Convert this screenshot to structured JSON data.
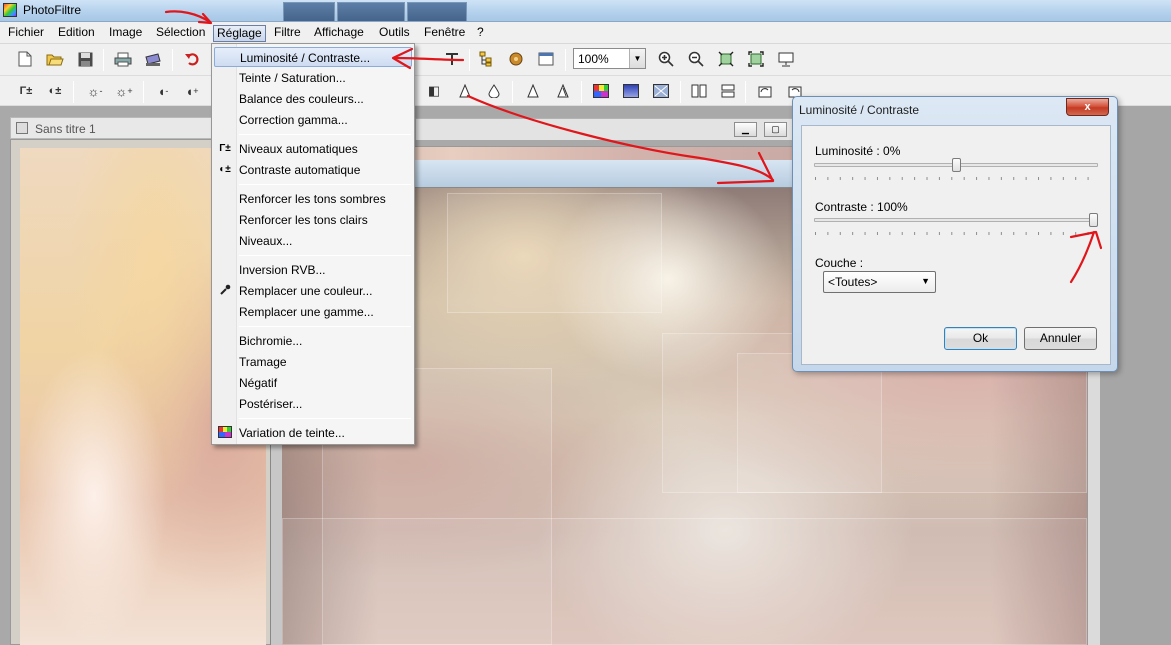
{
  "app": {
    "title": "PhotoFiltre"
  },
  "menubar": {
    "items": [
      {
        "label": "Fichier"
      },
      {
        "label": "Edition"
      },
      {
        "label": "Image"
      },
      {
        "label": "Sélection"
      },
      {
        "label": "Réglage"
      },
      {
        "label": "Filtre"
      },
      {
        "label": "Affichage"
      },
      {
        "label": "Outils"
      },
      {
        "label": "Fenêtre"
      },
      {
        "label": "?"
      }
    ]
  },
  "toolbar": {
    "zoom": "100%"
  },
  "document1": {
    "title": "Sans titre 1"
  },
  "reglage_menu": {
    "items": [
      {
        "label": "Luminosité / Contraste...",
        "highlighted": true
      },
      {
        "label": "Teinte / Saturation..."
      },
      {
        "label": "Balance des couleurs..."
      },
      {
        "label": "Correction gamma..."
      },
      {
        "label": "Niveaux automatiques",
        "icon": "gamma-auto-icon"
      },
      {
        "label": "Contraste automatique",
        "icon": "contrast-auto-icon"
      },
      {
        "label": "Renforcer les tons sombres"
      },
      {
        "label": "Renforcer les tons clairs"
      },
      {
        "label": "Niveaux..."
      },
      {
        "label": "Inversion RVB..."
      },
      {
        "label": "Remplacer une couleur...",
        "icon": "eyedropper-icon"
      },
      {
        "label": "Remplacer une gamme..."
      },
      {
        "label": "Bichromie..."
      },
      {
        "label": "Tramage"
      },
      {
        "label": "Négatif"
      },
      {
        "label": "Postériser..."
      },
      {
        "label": "Variation de teinte...",
        "icon": "color-palette-icon"
      }
    ]
  },
  "dialog": {
    "title": "Luminosité / Contraste",
    "close": "x",
    "brightness_label": "Luminosité : 0%",
    "brightness_value": 0,
    "contrast_label": "Contraste : 100%",
    "contrast_value": 100,
    "layer_label": "Couche :",
    "layer_value": "<Toutes>",
    "ok": "Ok",
    "cancel": "Annuler"
  },
  "colors": {
    "annotation": "#e0161b",
    "menu_highlight": "#cedcf1",
    "titlebar": "#b7d3ee"
  }
}
